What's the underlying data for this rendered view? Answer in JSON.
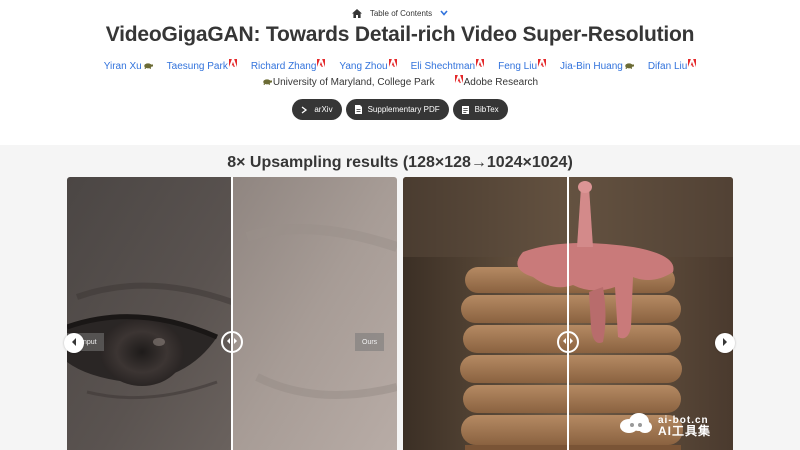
{
  "toc": {
    "label": "Table of Contents",
    "home_icon": "home-icon",
    "dropdown_icon": "chevron-down-icon"
  },
  "title": "VideoGigaGAN: Towards Detail-rich Video Super-Resolution",
  "authors": [
    {
      "name": "Yiran Xu",
      "affiliation": "turtle"
    },
    {
      "name": "Taesung Park",
      "affiliation": "adobe"
    },
    {
      "name": "Richard Zhang",
      "affiliation": "adobe"
    },
    {
      "name": "Yang Zhou",
      "affiliation": "adobe"
    },
    {
      "name": "Eli Shechtman",
      "affiliation": "adobe"
    },
    {
      "name": "Feng Liu",
      "affiliation": "adobe"
    },
    {
      "name": "Jia-Bin Huang",
      "affiliation": "turtle"
    },
    {
      "name": "Difan Liu",
      "affiliation": "adobe"
    }
  ],
  "affiliations": [
    {
      "mark": "turtle",
      "name": "University of Maryland, College Park"
    },
    {
      "mark": "adobe",
      "name": "Adobe Research"
    }
  ],
  "buttons": [
    {
      "label": "arXiv",
      "icon": "arxiv-icon"
    },
    {
      "label": "Supplementary PDF",
      "icon": "file-pdf-icon"
    },
    {
      "label": "BibTex",
      "icon": "document-icon"
    }
  ],
  "results": {
    "heading": "8× Upsampling results (128×128→1024×1024)",
    "left_tag": "Input",
    "right_tag": "Ours"
  },
  "watermark": {
    "top": "ai-bot.cn",
    "bottom": "AI工具集"
  },
  "colors": {
    "link": "#3273dc",
    "text": "#363636",
    "pill": "#363636",
    "section_bg": "#f5f5f5",
    "adobe": "#e4292b"
  }
}
